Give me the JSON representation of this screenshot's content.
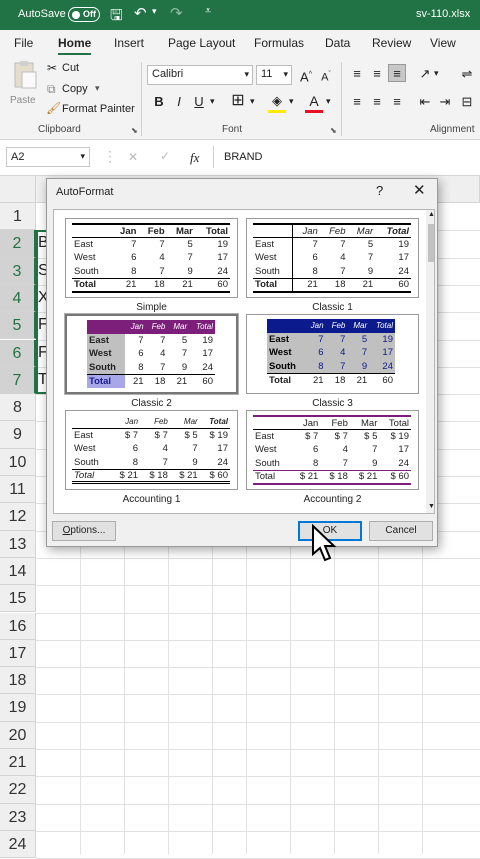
{
  "titlebar": {
    "autosave_label": "AutoSave",
    "toggle_state": "Off",
    "filename": "sv-110.xlsx",
    "bg": "#217346"
  },
  "tabs": [
    "File",
    "Home",
    "Insert",
    "Page Layout",
    "Formulas",
    "Data",
    "Review",
    "View"
  ],
  "ribbon": {
    "clipboard": {
      "paste": "Paste",
      "cut": "Cut",
      "copy": "Copy",
      "format_painter": "Format Painter",
      "group": "Clipboard"
    },
    "font": {
      "name": "Calibri",
      "size": "11",
      "group": "Font",
      "bold": "B",
      "italic": "I",
      "underline": "U"
    },
    "alignment": {
      "group": "Alignment"
    }
  },
  "formula_bar": {
    "name_box": "A2",
    "fx": "fx",
    "content": "BRAND"
  },
  "grid": {
    "rows": [
      "1",
      "2",
      "3",
      "4",
      "5",
      "6",
      "7",
      "8",
      "9",
      "10",
      "11",
      "12",
      "13",
      "14",
      "15",
      "16",
      "17",
      "18",
      "19",
      "20",
      "21",
      "22",
      "23",
      "24"
    ],
    "a_cells": [
      "",
      "B",
      "S",
      "X",
      "F",
      "F",
      "T"
    ]
  },
  "dialog": {
    "title": "AutoFormat",
    "help": "?",
    "close": "✕",
    "formats": [
      {
        "name": "Simple",
        "header": [
          "",
          "Jan",
          "Feb",
          "Mar",
          "Total"
        ],
        "rows": [
          [
            "East",
            "7",
            "7",
            "5",
            "19"
          ],
          [
            "West",
            "6",
            "4",
            "7",
            "17"
          ],
          [
            "South",
            "8",
            "7",
            "9",
            "24"
          ],
          [
            "Total",
            "21",
            "18",
            "21",
            "60"
          ]
        ]
      },
      {
        "name": "Classic 1",
        "header": [
          "",
          "Jan",
          "Feb",
          "Mar",
          "Total"
        ],
        "rows": [
          [
            "East",
            "7",
            "7",
            "5",
            "19"
          ],
          [
            "West",
            "6",
            "4",
            "7",
            "17"
          ],
          [
            "South",
            "8",
            "7",
            "9",
            "24"
          ],
          [
            "Total",
            "21",
            "18",
            "21",
            "60"
          ]
        ]
      },
      {
        "name": "Classic 2",
        "header": [
          "",
          "Jan",
          "Feb",
          "Mar",
          "Total"
        ],
        "rows": [
          [
            "East",
            "7",
            "7",
            "5",
            "19"
          ],
          [
            "West",
            "6",
            "4",
            "7",
            "17"
          ],
          [
            "South",
            "8",
            "7",
            "9",
            "24"
          ],
          [
            "Total",
            "21",
            "18",
            "21",
            "60"
          ]
        ]
      },
      {
        "name": "Classic 3",
        "header": [
          "",
          "Jan",
          "Feb",
          "Mar",
          "Total"
        ],
        "rows": [
          [
            "East",
            "7",
            "7",
            "5",
            "19"
          ],
          [
            "West",
            "6",
            "4",
            "7",
            "17"
          ],
          [
            "South",
            "8",
            "7",
            "9",
            "24"
          ],
          [
            "Total",
            "21",
            "18",
            "21",
            "60"
          ]
        ]
      },
      {
        "name": "Accounting 1",
        "header": [
          "",
          "Jan",
          "Feb",
          "Mar",
          "Total"
        ],
        "rows": [
          [
            "East",
            "$       7",
            "$       7",
            "$       5",
            "$   19"
          ],
          [
            "West",
            "6",
            "4",
            "7",
            "17"
          ],
          [
            "South",
            "8",
            "7",
            "9",
            "24"
          ],
          [
            "Total",
            "$     21",
            "$     18",
            "$     21",
            "$   60"
          ]
        ]
      },
      {
        "name": "Accounting 2",
        "header": [
          "",
          "Jan",
          "Feb",
          "Mar",
          "Total"
        ],
        "rows": [
          [
            "East",
            "$       7",
            "$       7",
            "$       5",
            "$   19"
          ],
          [
            "West",
            "6",
            "4",
            "7",
            "17"
          ],
          [
            "South",
            "8",
            "7",
            "9",
            "24"
          ],
          [
            "Total",
            "$     21",
            "$     18",
            "$     21",
            "$   60"
          ]
        ]
      }
    ],
    "options_button": "Options...",
    "ok_button": "OK",
    "cancel_button": "Cancel",
    "accent": "#7b1f7a",
    "navy": "#0b1a8c"
  }
}
